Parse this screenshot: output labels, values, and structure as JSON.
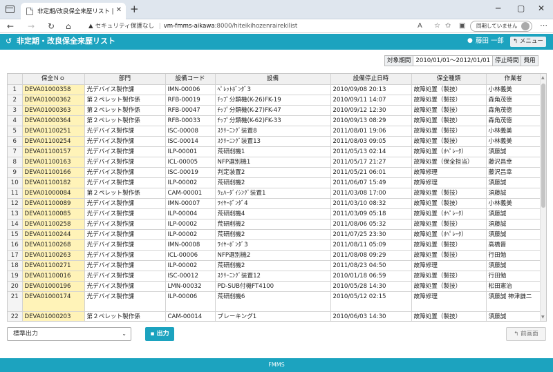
{
  "browser": {
    "tab_title": "非定期/改良保全来歴リスト | 設備",
    "security_label": "セキュリティ保護なし",
    "url_host": "vm-fmms-aikawa",
    "url_path": ":8000/hiteikihozenrairekilist",
    "profile_label": "同期していません"
  },
  "app": {
    "title": "非定期・改良保全来歴リスト",
    "user_name": "藤田 一郎",
    "menu_label": "メニュー"
  },
  "filter": {
    "period_label": "対象期間",
    "period_value": "2010/01/01～2012/01/01",
    "stop_time_label": "停止時間",
    "cost_label": "費用"
  },
  "table": {
    "headers": [
      "",
      "保全Ｎｏ",
      "部門",
      "設備コード",
      "設備",
      "設備停止日時",
      "保全種類",
      "作業者"
    ],
    "rows": [
      [
        "1",
        "DEVA01000358",
        "光デバイス製作課",
        "IMN-00006",
        "ﾍﾟﾚｯﾄﾎﾞﾝﾀﾞ3",
        "2010/09/08 20:13",
        "故障処置（製技）",
        "小林義美"
      ],
      [
        "2",
        "DEVA01000362",
        "第２ペレット製作係",
        "RFB-00019",
        "ﾁｯﾌﾟ分類機(K-26)FK-19",
        "2010/09/11 14:07",
        "故障処置（製技）",
        "森角茂徳"
      ],
      [
        "3",
        "DEVA01000363",
        "第２ペレット製作係",
        "RFB-00047",
        "ﾁｯﾌﾟ分類機(K-27)FK-47",
        "2010/09/12 12:30",
        "故障処置（製技）",
        "森角茂徳"
      ],
      [
        "4",
        "DEVA01000364",
        "第２ペレット製作係",
        "RFB-00033",
        "ﾁｯﾌﾟ分類機(K-62)FK-33",
        "2010/09/13 08:29",
        "故障処置（製技）",
        "森角茂徳"
      ],
      [
        "5",
        "DEVA01100251",
        "光デバイス製作課",
        "ISC-00008",
        "ｽｸﾘｰﾆﾝｸﾞ装置8",
        "2011/08/01 19:06",
        "故障処置（製技）",
        "小林義美"
      ],
      [
        "6",
        "DEVA01100254",
        "光デバイス製作課",
        "ISC-00014",
        "ｽｸﾘｰﾆﾝｸﾞ装置13",
        "2011/08/03 09:05",
        "故障処置（製技）",
        "小林義美"
      ],
      [
        "7",
        "DEVA01100157",
        "光デバイス製作課",
        "ILP-00001",
        "荒研削機1",
        "2011/05/13 02:14",
        "故障処置（ｵﾍﾟﾚｰﾀ）",
        "須藤誠"
      ],
      [
        "8",
        "DEVA01100163",
        "光デバイス製作課",
        "ICL-00005",
        "NFP選別機1",
        "2011/05/17 21:27",
        "故障処置（保全担当）",
        "藤沢昌幸"
      ],
      [
        "9",
        "DEVA01100166",
        "光デバイス製作課",
        "ISC-00019",
        "判定装置2",
        "2011/05/21 06:01",
        "故障修理",
        "藤沢昌幸"
      ],
      [
        "10",
        "DEVA01100182",
        "光デバイス製作課",
        "ILP-00002",
        "荒研削機2",
        "2011/06/07 15:49",
        "故障修理",
        "須藤誠"
      ],
      [
        "11",
        "DEVA01000084",
        "第２ペレット製作係",
        "CAM-00001",
        "ｳｪﾊｰﾀﾞｲｼﾝｸﾞ装置1",
        "2011/03/08 17:00",
        "故障処置（製技）",
        "須藤誠"
      ],
      [
        "12",
        "DEVA01100089",
        "光デバイス製作課",
        "IMN-00007",
        "ﾜｲﾔｰﾎﾞﾝﾀﾞ4",
        "2011/03/10 08:32",
        "故障処置（製技）",
        "小林義美"
      ],
      [
        "13",
        "DEVA01100085",
        "光デバイス製作課",
        "ILP-00004",
        "荒研削機4",
        "2011/03/09 05:18",
        "故障処置（ｵﾍﾟﾚｰﾀ）",
        "須藤誠"
      ],
      [
        "14",
        "DEVA01100258",
        "光デバイス製作課",
        "ILP-00002",
        "荒研削機2",
        "2011/08/06 05:32",
        "故障処置（製技）",
        "須藤誠"
      ],
      [
        "15",
        "DEVA01100244",
        "光デバイス製作課",
        "ILP-00002",
        "荒研削機2",
        "2011/07/25 23:30",
        "故障処置（ｵﾍﾟﾚｰﾀ）",
        "須藤誠"
      ],
      [
        "16",
        "DEVA01100268",
        "光デバイス製作課",
        "IMN-00008",
        "ﾜｲﾔｰﾎﾞﾝﾀﾞ3",
        "2011/08/11 05:09",
        "故障処置（製技）",
        "高橋晋"
      ],
      [
        "17",
        "DEVA01100263",
        "光デバイス製作課",
        "ICL-00006",
        "NFP選別機2",
        "2011/08/08 09:29",
        "故障処置（製技）",
        "行田勉"
      ],
      [
        "18",
        "DEVA01100271",
        "光デバイス製作課",
        "ILP-00002",
        "荒研削機2",
        "2011/08/23 04:50",
        "故障修理",
        "須藤誠"
      ],
      [
        "19",
        "DEVA01100016",
        "光デバイス製作課",
        "ISC-00012",
        "ｽｸﾘｰﾆﾝｸﾞ装置12",
        "2010/01/18 06:59",
        "故障処置（製技）",
        "行田勉"
      ],
      [
        "20",
        "DEVA01000196",
        "光デバイス製作課",
        "LMN-00032",
        "PD-SUB付機FT4100",
        "2010/05/28 14:30",
        "故障処置（製技）",
        "松田憲治"
      ],
      [
        "21",
        "DEVA01000174",
        "光デバイス製作課",
        "ILP-00006",
        "荒研削機6",
        "2010/05/12 02:15",
        "故障修理",
        "須藤誠 神津謙二"
      ],
      [
        "22",
        "DEVA01000203",
        "第２ペレット製作係",
        "CAM-00014",
        "ブレーキング1",
        "2010/06/03 14:30",
        "故障処置（製技）",
        "須藤誠"
      ]
    ]
  },
  "controls": {
    "output_select_value": "標準出力",
    "output_button_label": "出力",
    "prev_button_label": "前画面"
  },
  "footer": {
    "label": "FMMS"
  },
  "colors": {
    "accent": "#1ca3bf",
    "key_cell": "#fff3b8"
  }
}
